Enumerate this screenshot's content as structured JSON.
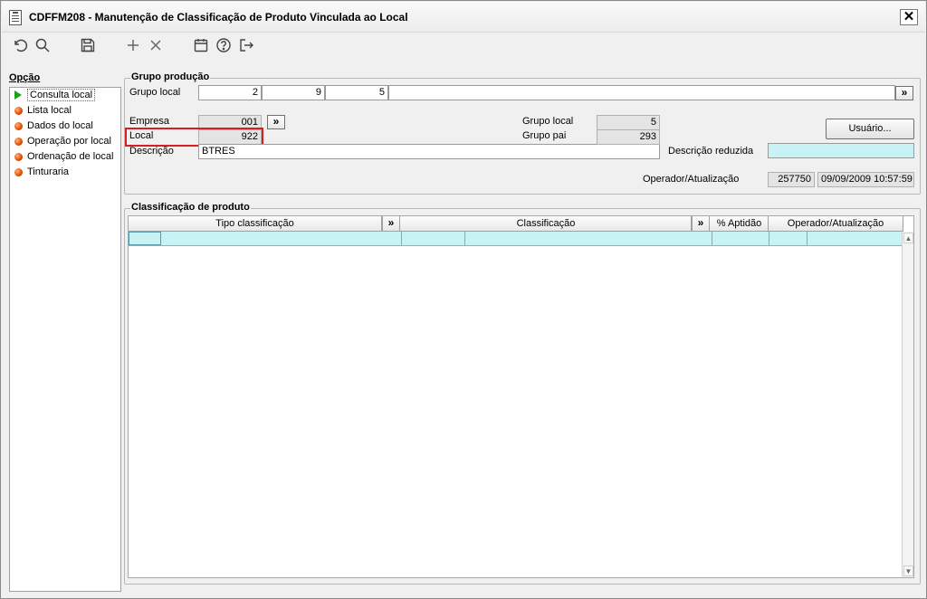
{
  "window": {
    "title": "CDFFM208 - Manutenção de Classificação de Produto Vinculada ao Local",
    "close_glyph": "✕"
  },
  "toolbar": {
    "icons": [
      "undo-icon",
      "search-icon",
      "save-icon",
      "add-icon",
      "delete-icon",
      "calendar-icon",
      "help-icon",
      "exit-icon"
    ]
  },
  "opcao": {
    "label": "Opção",
    "items": [
      {
        "label": "Consulta local",
        "selected": true
      },
      {
        "label": "Lista local"
      },
      {
        "label": "Dados do local"
      },
      {
        "label": "Operação por local"
      },
      {
        "label": "Ordenação de local"
      },
      {
        "label": "Tinturaria"
      }
    ]
  },
  "grupo_producao": {
    "legend": "Grupo produção",
    "grupo_local_label": "Grupo local",
    "grupo_local_values": [
      "2",
      "9",
      "5"
    ],
    "expand_glyph": "»",
    "empresa_label": "Empresa",
    "empresa_value": "001",
    "local_label": "Local",
    "local_value": "922",
    "descricao_label": "Descrição",
    "descricao_value": "BTRES",
    "right_grupo_local_label": "Grupo local",
    "right_grupo_local_value": "5",
    "grupo_pai_label": "Grupo pai",
    "grupo_pai_value": "293",
    "usuario_button": "Usuário...",
    "descricao_reduzida_label": "Descrição reduzida",
    "descricao_reduzida_value": "",
    "operador_label": "Operador/Atualização",
    "operador_value": "257750",
    "atualizacao_value": "09/09/2009 10:57:59"
  },
  "classificacao": {
    "legend": "Classificação de produto",
    "columns": {
      "tipo": "Tipo classificação",
      "classificacao": "Classificação",
      "aptidao": "% Aptidão",
      "operador": "Operador/Atualização"
    },
    "expand_glyph": "»"
  },
  "colors": {
    "highlight": "#d42020",
    "row_selected": "#c8f3f5",
    "bullet": "#e04a00",
    "arrow": "#1ea01e"
  }
}
